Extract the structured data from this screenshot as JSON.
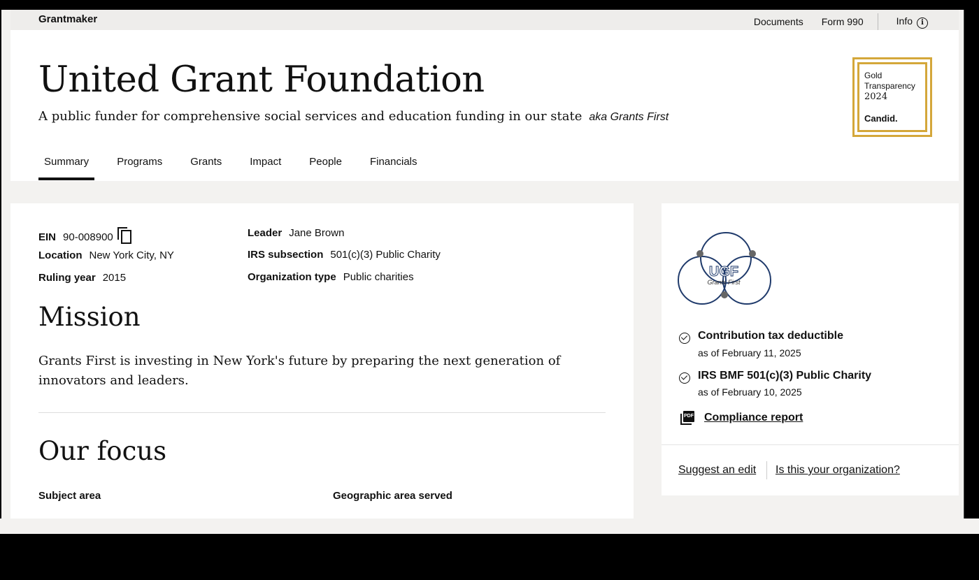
{
  "topbar": {
    "brand": "Grantmaker",
    "links": [
      "Documents",
      "Form 990"
    ],
    "info_label": "Info"
  },
  "header": {
    "title": "United Grant Foundation",
    "tagline": "A public funder for comprehensive social services and education funding in our state",
    "aka": "aka Grants First",
    "seal": {
      "line1": "Gold",
      "line2": "Transparency",
      "year": "2024",
      "brand": "Candid."
    }
  },
  "tabs": [
    "Summary",
    "Programs",
    "Grants",
    "Impact",
    "People",
    "Financials"
  ],
  "details": {
    "ein_label": "EIN",
    "ein_value": "90-008900",
    "location_label": "Location",
    "location_value": "New York City, NY",
    "ruling_label": "Ruling year",
    "ruling_value": "2015",
    "leader_label": "Leader",
    "leader_value": "Jane Brown",
    "irs_label": "IRS subsection",
    "irs_value": "501(c)(3) Public Charity",
    "orgtype_label": "Organization type",
    "orgtype_value": "Public charities"
  },
  "mission": {
    "heading": "Mission",
    "text": "Grants First is investing in New York's future by preparing the next generation of innovators and leaders."
  },
  "focus": {
    "heading": "Our focus",
    "subject_label": "Subject area",
    "geo_label": "Geographic area served"
  },
  "sidebar": {
    "logo_text": "UGF",
    "logo_sub": "Grants First",
    "statuses": [
      {
        "title": "Contribution tax deductible",
        "date": "as of February 11, 2025"
      },
      {
        "title": "IRS BMF 501(c)(3) Public Charity",
        "date": "as of February 10, 2025"
      }
    ],
    "compliance_label": "Compliance report",
    "pdf_label": "PDF",
    "suggest_edit": "Suggest an edit",
    "claim_org": "Is this your organization?"
  },
  "colors": {
    "seal_gold": "#d4a73a",
    "logo_navy": "#1f3a6b",
    "page_bg": "#f3f2f0"
  },
  "icons": [
    "info-icon",
    "copy-icon",
    "check-circle-icon",
    "pdf-icon"
  ]
}
